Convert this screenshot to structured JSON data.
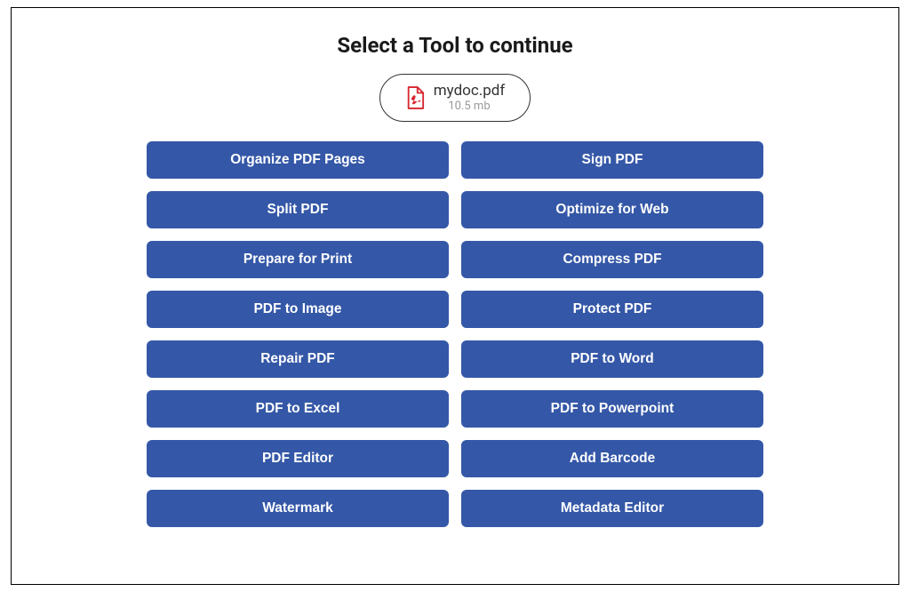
{
  "header": {
    "title": "Select a Tool to continue"
  },
  "file": {
    "name": "mydoc.pdf",
    "size": "10.5 mb"
  },
  "tools": {
    "left": [
      {
        "label": "Organize PDF Pages"
      },
      {
        "label": "Split PDF"
      },
      {
        "label": "Prepare for Print"
      },
      {
        "label": "PDF to Image"
      },
      {
        "label": "Repair PDF"
      },
      {
        "label": "PDF to Excel"
      },
      {
        "label": "PDF Editor"
      },
      {
        "label": "Watermark"
      }
    ],
    "right": [
      {
        "label": "Sign PDF"
      },
      {
        "label": "Optimize for Web"
      },
      {
        "label": "Compress PDF"
      },
      {
        "label": "Protect PDF"
      },
      {
        "label": "PDF to Word"
      },
      {
        "label": "PDF to Powerpoint"
      },
      {
        "label": "Add Barcode"
      },
      {
        "label": "Metadata Editor"
      }
    ]
  },
  "colors": {
    "button_bg": "#3457a7",
    "pdf_icon": "#d7262e"
  }
}
